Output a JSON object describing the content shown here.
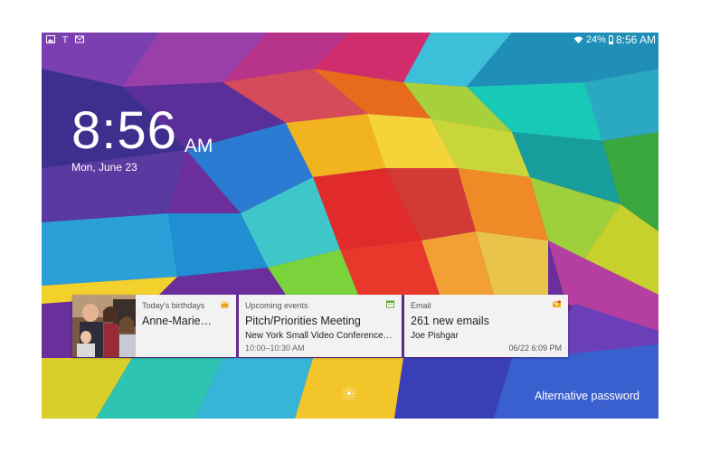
{
  "statusbar": {
    "left_icons": [
      "gallery-icon",
      "nytimes-icon",
      "email-notify-icon"
    ],
    "wifi_icon": "wifi-icon",
    "battery_percent": "24%",
    "battery_icon": "battery-icon",
    "time": "8:56 AM"
  },
  "clock": {
    "time": "8:56",
    "ampm": "AM",
    "date": "Mon, June 23"
  },
  "cards": {
    "birthday": {
      "header": "Today's birthdays",
      "icon": "cake-icon",
      "name": "Anne-Marie…"
    },
    "events": {
      "header": "Upcoming events",
      "icon": "calendar-icon",
      "title": "Pitch/Priorities Meeting",
      "location": "New York Small Video Conference…",
      "time_range": "10:00–10:30 AM"
    },
    "email": {
      "header": "Email",
      "icon": "email-icon",
      "count_text": "261 new emails",
      "sender": "Joe Pishgar",
      "datetime": "06/22 6:09 PM"
    }
  },
  "unlock": {
    "icon": "unlock-ripple-icon"
  },
  "alt_password": "Alternative password"
}
